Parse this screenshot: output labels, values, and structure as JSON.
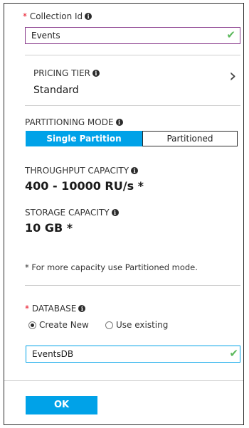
{
  "collection": {
    "label": "Collection Id",
    "required_marker": "*",
    "info": "i",
    "value": "Events",
    "valid_icon": "✔"
  },
  "pricing": {
    "label": "PRICING TIER",
    "info": "i",
    "value": "Standard",
    "chevron": "›"
  },
  "partitioning": {
    "label": "PARTITIONING MODE",
    "info": "i",
    "options": [
      "Single Partition",
      "Partitioned"
    ],
    "selected": "Single Partition"
  },
  "throughput": {
    "label": "THROUGHPUT CAPACITY",
    "info": "i",
    "value": "400 - 10000 RU/s *"
  },
  "storage": {
    "label": "STORAGE CAPACITY",
    "info": "i",
    "value": "10 GB *",
    "note": "* For more capacity use Partitioned mode."
  },
  "database": {
    "label": "DATABASE",
    "required_marker": "*",
    "info": "i",
    "options": [
      "Create New",
      "Use existing"
    ],
    "selected": "Create New",
    "value": "EventsDB",
    "valid_icon": "✔"
  },
  "ok_button": {
    "label": "OK"
  },
  "colors": {
    "accent": "#00a2e8",
    "required": "#e81123",
    "valid": "#5cb85c",
    "input_border": "#8b3f8f"
  },
  "icons": {
    "info": "info-icon",
    "valid": "check-icon",
    "chevron": "chevron-right-icon"
  }
}
